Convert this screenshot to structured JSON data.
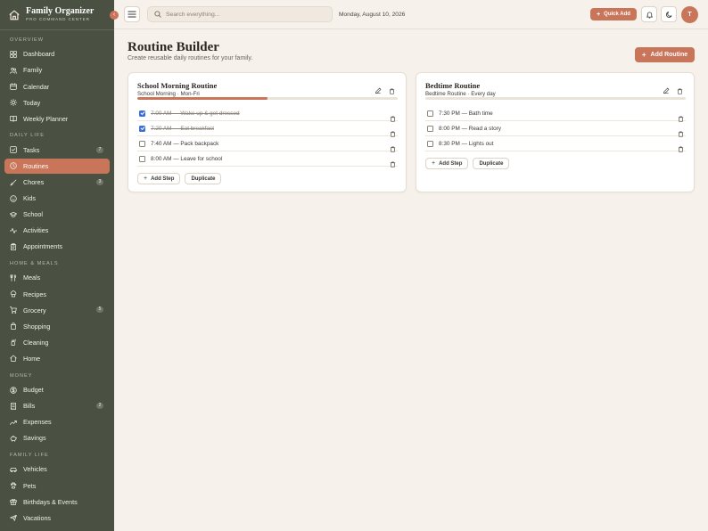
{
  "brand": {
    "title": "Family Organizer",
    "subtitle": "PRO COMMAND CENTER"
  },
  "collapse_glyph": "‹",
  "nav": {
    "overview_label": "OVERVIEW",
    "overview": [
      {
        "label": "Dashboard",
        "icon": "grid-icon"
      },
      {
        "label": "Family",
        "icon": "users-icon"
      },
      {
        "label": "Calendar",
        "icon": "calendar-icon"
      },
      {
        "label": "Today",
        "icon": "sun-icon"
      },
      {
        "label": "Weekly Planner",
        "icon": "book-icon"
      }
    ],
    "daily_label": "DAILY LIFE",
    "daily": [
      {
        "label": "Tasks",
        "icon": "check-square-icon",
        "badge": "7"
      },
      {
        "label": "Routines",
        "icon": "clock-icon",
        "active": true
      },
      {
        "label": "Chores",
        "icon": "brush-icon",
        "badge": "3"
      },
      {
        "label": "Kids",
        "icon": "smile-icon"
      },
      {
        "label": "School",
        "icon": "graduation-icon"
      },
      {
        "label": "Activities",
        "icon": "activity-icon"
      },
      {
        "label": "Appointments",
        "icon": "clipboard-icon"
      }
    ],
    "home_label": "HOME & MEALS",
    "home": [
      {
        "label": "Meals",
        "icon": "utensils-icon"
      },
      {
        "label": "Recipes",
        "icon": "chef-hat-icon"
      },
      {
        "label": "Grocery",
        "icon": "cart-icon",
        "badge": "5"
      },
      {
        "label": "Shopping",
        "icon": "bag-icon"
      },
      {
        "label": "Cleaning",
        "icon": "spray-icon"
      },
      {
        "label": "Home",
        "icon": "house-icon"
      }
    ],
    "money_label": "MONEY",
    "money": [
      {
        "label": "Budget",
        "icon": "dollar-icon"
      },
      {
        "label": "Bills",
        "icon": "receipt-icon",
        "badge": "2"
      },
      {
        "label": "Expenses",
        "icon": "trend-icon"
      },
      {
        "label": "Savings",
        "icon": "piggy-icon"
      }
    ],
    "family_label": "FAMILY LIFE",
    "family": [
      {
        "label": "Vehicles",
        "icon": "car-icon"
      },
      {
        "label": "Pets",
        "icon": "paw-icon"
      },
      {
        "label": "Birthdays & Events",
        "icon": "gift-icon"
      },
      {
        "label": "Vacations",
        "icon": "plane-icon"
      }
    ]
  },
  "topbar": {
    "search_placeholder": "Search everything...",
    "date": "Monday, August 10, 2026",
    "quick_add": "Quick Add",
    "avatar_initial": "T"
  },
  "page": {
    "title": "Routine Builder",
    "subtitle": "Create reusable daily routines for your family.",
    "add_routine": "Add Routine"
  },
  "routines": [
    {
      "title": "School Morning Routine",
      "meta": "School Morning · Mon-Fri",
      "progress": 0.5,
      "steps": [
        {
          "text": "7:00 AM — Wake up & get dressed",
          "done": true
        },
        {
          "text": "7:20 AM — Eat breakfast",
          "done": true
        },
        {
          "text": "7:40 AM — Pack backpack",
          "done": false
        },
        {
          "text": "8:00 AM — Leave for school",
          "done": false
        }
      ],
      "add_step": "Add Step",
      "duplicate": "Duplicate"
    },
    {
      "title": "Bedtime Routine",
      "meta": "Bedtime Routine · Every day",
      "progress": 0,
      "steps": [
        {
          "text": "7:30 PM — Bath time",
          "done": false
        },
        {
          "text": "8:00 PM — Read a story",
          "done": false
        },
        {
          "text": "8:30 PM — Lights out",
          "done": false
        }
      ],
      "add_step": "Add Step",
      "duplicate": "Duplicate"
    }
  ],
  "colors": {
    "sidebar": "#4a5142",
    "accent": "#c97559",
    "background": "#f6f1ea",
    "checkbox": "#3b6fd6"
  }
}
